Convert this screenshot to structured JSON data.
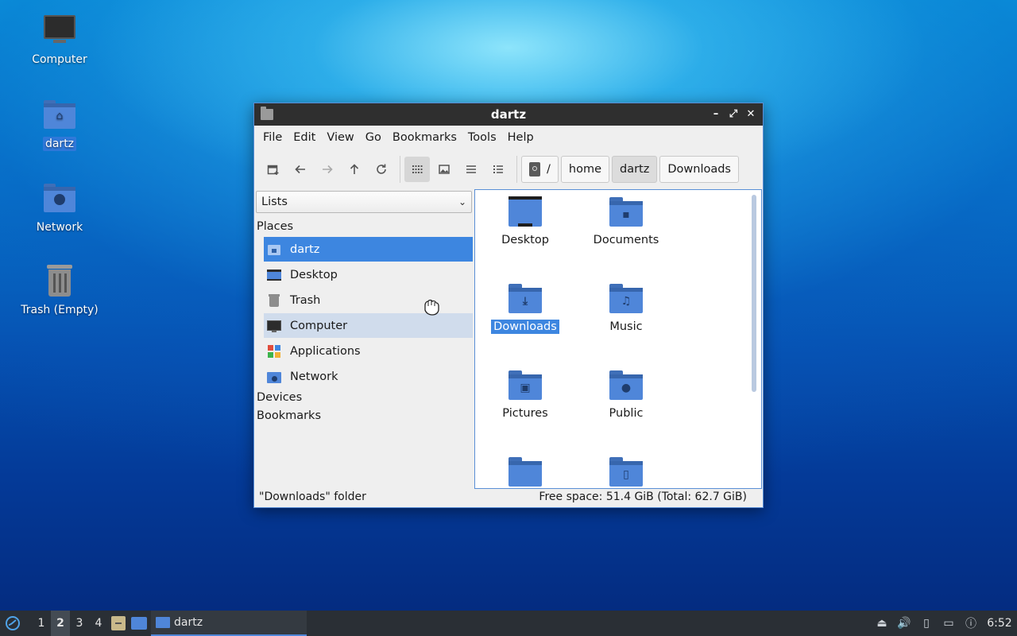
{
  "desktop": {
    "icons": [
      {
        "label": "Computer",
        "icon": "computer-icon"
      },
      {
        "label": "dartz",
        "icon": "home-folder-icon"
      },
      {
        "label": "Network",
        "icon": "network-folder-icon"
      },
      {
        "label": "Trash (Empty)",
        "icon": "trash-icon"
      }
    ]
  },
  "window": {
    "title": "dartz",
    "controls": {
      "minimize": "minimize-icon",
      "maximize": "maximize-icon",
      "close": "close-icon"
    },
    "menu": [
      "File",
      "Edit",
      "View",
      "Go",
      "Bookmarks",
      "Tools",
      "Help"
    ],
    "toolbar": {
      "buttons": [
        "new-tab-icon",
        "back-icon",
        "forward-icon",
        "up-icon",
        "reload-icon",
        "icon-view-icon",
        "thumbnail-view-icon",
        "compact-view-icon",
        "detailed-list-icon"
      ],
      "path": [
        "/",
        "home",
        "dartz",
        "Downloads"
      ],
      "current_path_item": "dartz"
    },
    "sidebar": {
      "mode": "Lists",
      "places_header": "Places",
      "places": [
        {
          "label": "dartz",
          "icon": "home-folder-icon",
          "state": "selected"
        },
        {
          "label": "Desktop",
          "icon": "desktop-icon",
          "state": ""
        },
        {
          "label": "Trash",
          "icon": "trash-icon",
          "state": ""
        },
        {
          "label": "Computer",
          "icon": "computer-icon",
          "state": "hover"
        },
        {
          "label": "Applications",
          "icon": "applications-icon",
          "state": ""
        },
        {
          "label": "Network",
          "icon": "network-folder-icon",
          "state": ""
        }
      ],
      "devices_header": "Devices",
      "bookmarks_header": "Bookmarks"
    },
    "files": [
      {
        "label": "Desktop",
        "icon": "desktop-folder-icon"
      },
      {
        "label": "Documents",
        "icon": "documents-folder-icon"
      },
      {
        "label": "Downloads",
        "icon": "downloads-folder-icon",
        "selected": true
      },
      {
        "label": "Music",
        "icon": "music-folder-icon"
      },
      {
        "label": "Pictures",
        "icon": "pictures-folder-icon"
      },
      {
        "label": "Public",
        "icon": "public-folder-icon"
      },
      {
        "label": "",
        "icon": "folder-icon"
      },
      {
        "label": "",
        "icon": "templates-folder-icon"
      }
    ],
    "status": {
      "left": "\"Downloads\" folder",
      "right": "Free space: 51.4 GiB (Total: 62.7 GiB)"
    }
  },
  "taskbar": {
    "workspaces": [
      "1",
      "2",
      "3",
      "4"
    ],
    "active_workspace": "2",
    "task_label": "dartz",
    "clock": "6:52"
  },
  "colors": {
    "accent": "#3d86e0",
    "folder": "#4f86d9",
    "taskbar": "#2a2f35"
  }
}
